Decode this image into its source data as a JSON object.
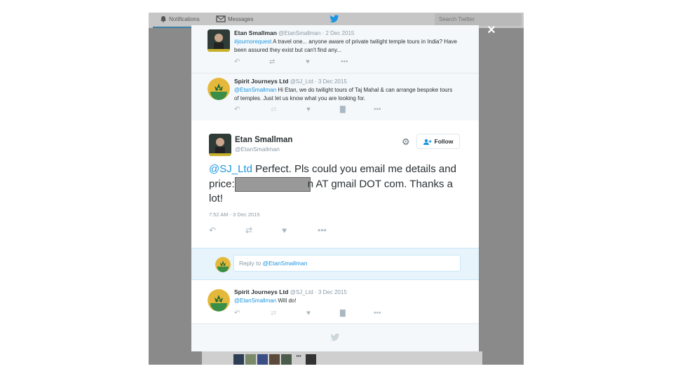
{
  "background": {
    "nav": {
      "notifications": "Notifications",
      "messages": "Messages"
    },
    "search_placeholder": "Search Twitter",
    "overflow_more": "•••"
  },
  "modal": {
    "close_label": "×",
    "context_tweets": [
      {
        "name": "Etan Smallman",
        "handle": "@EtanSmallman",
        "date": "2 Dec 2015",
        "hashtag": "#journorequest",
        "text": " A travel one... anyone aware of private twilight temple tours in India? Have been assured they exist but can't find any..."
      },
      {
        "name": "Spirit Journeys Ltd",
        "handle": "@SJ_Ltd",
        "date": "3 Dec 2015",
        "mention": "@EtanSmallman",
        "text": " Hi Etan, we do twilight tours of Taj Mahal & can arrange bespoke tours of temples. Just let us know what you are looking for."
      }
    ],
    "main_tweet": {
      "name": "Etan Smallman",
      "handle": "@EtanSmallman",
      "follow_label": "Follow",
      "mention": "@SJ_Ltd",
      "text_before": " Perfect. Pls could you email me details and price:",
      "text_after": "n AT gmail DOT com. Thanks a lot!",
      "timestamp": "7:52 AM - 3 Dec 2015"
    },
    "reply": {
      "prefix": "Reply to ",
      "mention": "@EtanSmallman"
    },
    "reply_tweet": {
      "name": "Spirit Journeys Ltd",
      "handle": "@SJ_Ltd",
      "date": "3 Dec 2015",
      "mention": "@EtanSmallman",
      "text": " Will do!"
    }
  },
  "colors": {
    "link": "#1b95e0",
    "text": "#292f33",
    "muted": "#8899a6",
    "action": "#aab8c2",
    "reply_bg": "#e8f4fb"
  }
}
